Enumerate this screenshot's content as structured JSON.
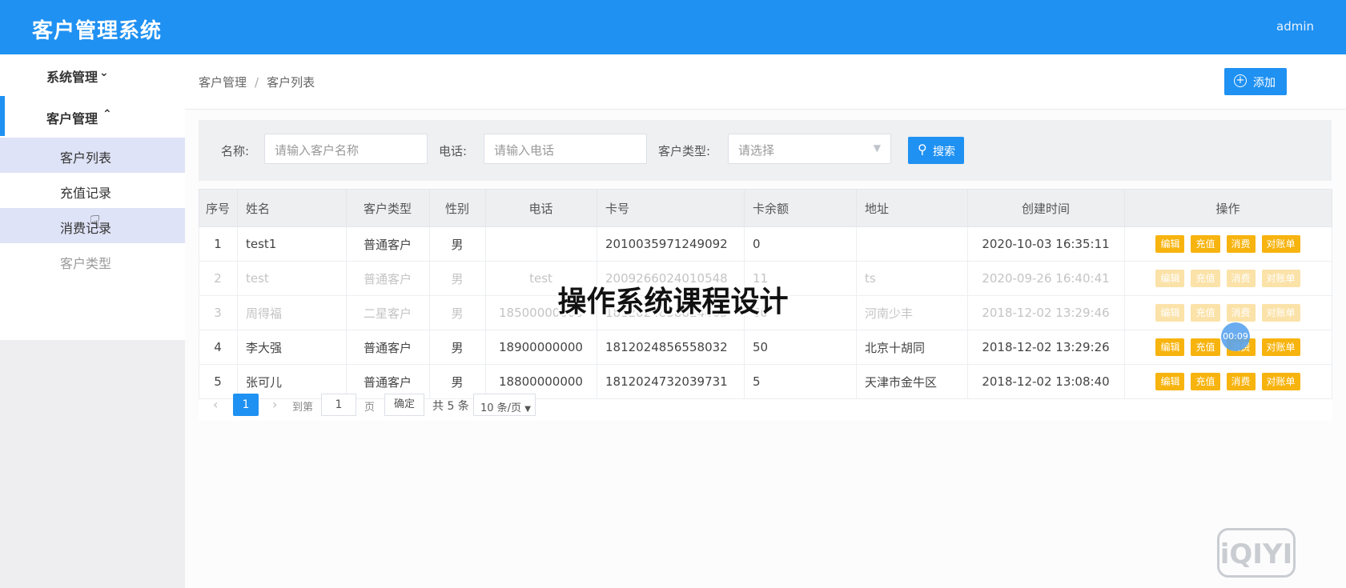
{
  "app": {
    "title": "客户管理系统",
    "user": "admin"
  },
  "sidebar": {
    "groups": [
      {
        "label": "系统管理",
        "chevron": "chevron-down-icon"
      },
      {
        "label": "客户管理",
        "chevron": "chevron-up-icon"
      }
    ],
    "items": [
      {
        "label": "客户列表"
      },
      {
        "label": "充值记录"
      },
      {
        "label": "消费记录"
      },
      {
        "label": "客户类型"
      }
    ]
  },
  "breadcrumb": {
    "root": "客户管理",
    "separator": "/",
    "current": "客户列表"
  },
  "toolbar": {
    "add_label": "添加"
  },
  "search": {
    "name_label": "名称:",
    "name_placeholder": "请输入客户名称",
    "phone_label": "电话:",
    "phone_placeholder": "请输入电话",
    "type_label": "客户类型:",
    "type_placeholder": "请选择",
    "button_label": "搜索"
  },
  "table": {
    "columns": [
      "序号",
      "姓名",
      "客户类型",
      "性别",
      "电话",
      "卡号",
      "卡余额",
      "地址",
      "创建时间",
      "操作"
    ],
    "actions": [
      "编辑",
      "充值",
      "消费",
      "对账单"
    ],
    "rows": [
      {
        "no": "1",
        "name": "test1",
        "type": "普通客户",
        "gender": "男",
        "phone": "",
        "card": "2010035971249092",
        "balance": "0",
        "address": "",
        "created": "2020-10-03 16:35:11"
      },
      {
        "no": "2",
        "name": "test",
        "type": "普通客户",
        "gender": "男",
        "phone": "test",
        "card": "2009266024010548",
        "balance": "11",
        "address": "ts",
        "created": "2020-09-26 16:40:41"
      },
      {
        "no": "3",
        "name": "周得福",
        "type": "二星客户",
        "gender": "男",
        "phone": "18500000000",
        "card": "1812024858624463",
        "balance": "60",
        "address": "河南少丰",
        "created": "2018-12-02 13:29:46"
      },
      {
        "no": "4",
        "name": "李大强",
        "type": "普通客户",
        "gender": "男",
        "phone": "18900000000",
        "card": "1812024856558032",
        "balance": "50",
        "address": "北京十胡同",
        "created": "2018-12-02 13:29:26"
      },
      {
        "no": "5",
        "name": "张可儿",
        "type": "普通客户",
        "gender": "男",
        "phone": "18800000000",
        "card": "1812024732039731",
        "balance": "5",
        "address": "天津市金牛区",
        "created": "2018-12-02 13:08:40"
      }
    ]
  },
  "pagination": {
    "current_page": "1",
    "goto_label": "到第",
    "goto_value": "1",
    "page_label": "页",
    "confirm_label": "确定",
    "total_label": "共 5 条",
    "page_size": "10 条/页"
  },
  "overlay": {
    "title": "操作系统课程设计",
    "timer": "00:09",
    "watermark": "iQIYI"
  }
}
